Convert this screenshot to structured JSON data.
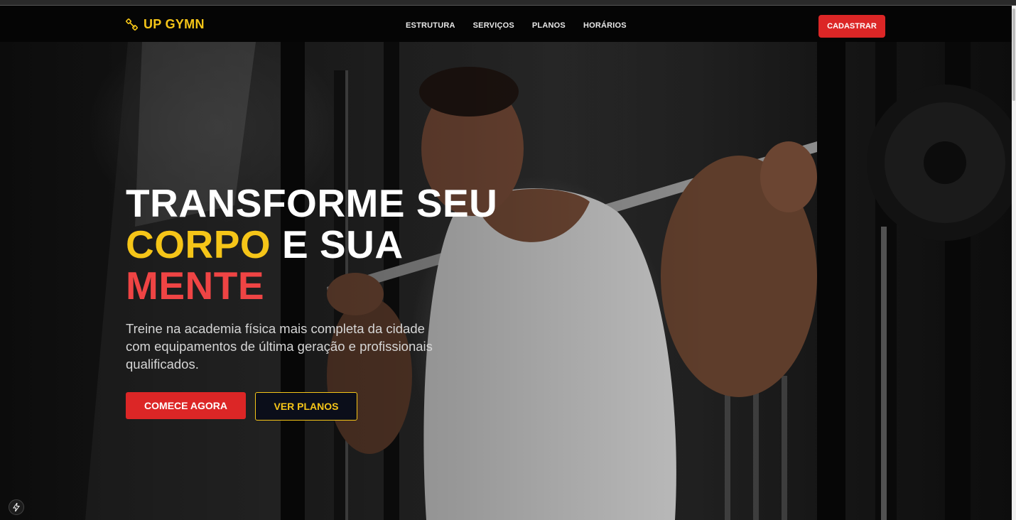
{
  "navbar": {
    "brand": "UP GYMN",
    "links": [
      "ESTRUTURA",
      "SERVIÇOS",
      "PLANOS",
      "HORÁRIOS"
    ],
    "cta": "CADASTRAR"
  },
  "hero": {
    "headline_line1": "TRANSFORME SEU",
    "headline_word_yellow": "CORPO",
    "headline_rest_line2": " E SUA",
    "headline_word_red": "MENTE",
    "subtitle": "Treine na academia física mais completa da cidade com equipamentos de última geração e profissionais qualificados.",
    "primary_button": "COMECE AGORA",
    "secondary_button": "VER PLANOS"
  },
  "colors": {
    "accent_yellow": "#f5c518",
    "accent_red": "#dc2626",
    "headline_red": "#ef4444",
    "navbar_bg": "#050505"
  },
  "icons": {
    "brand": "dumbbell-icon",
    "badge": "bolt-icon"
  }
}
